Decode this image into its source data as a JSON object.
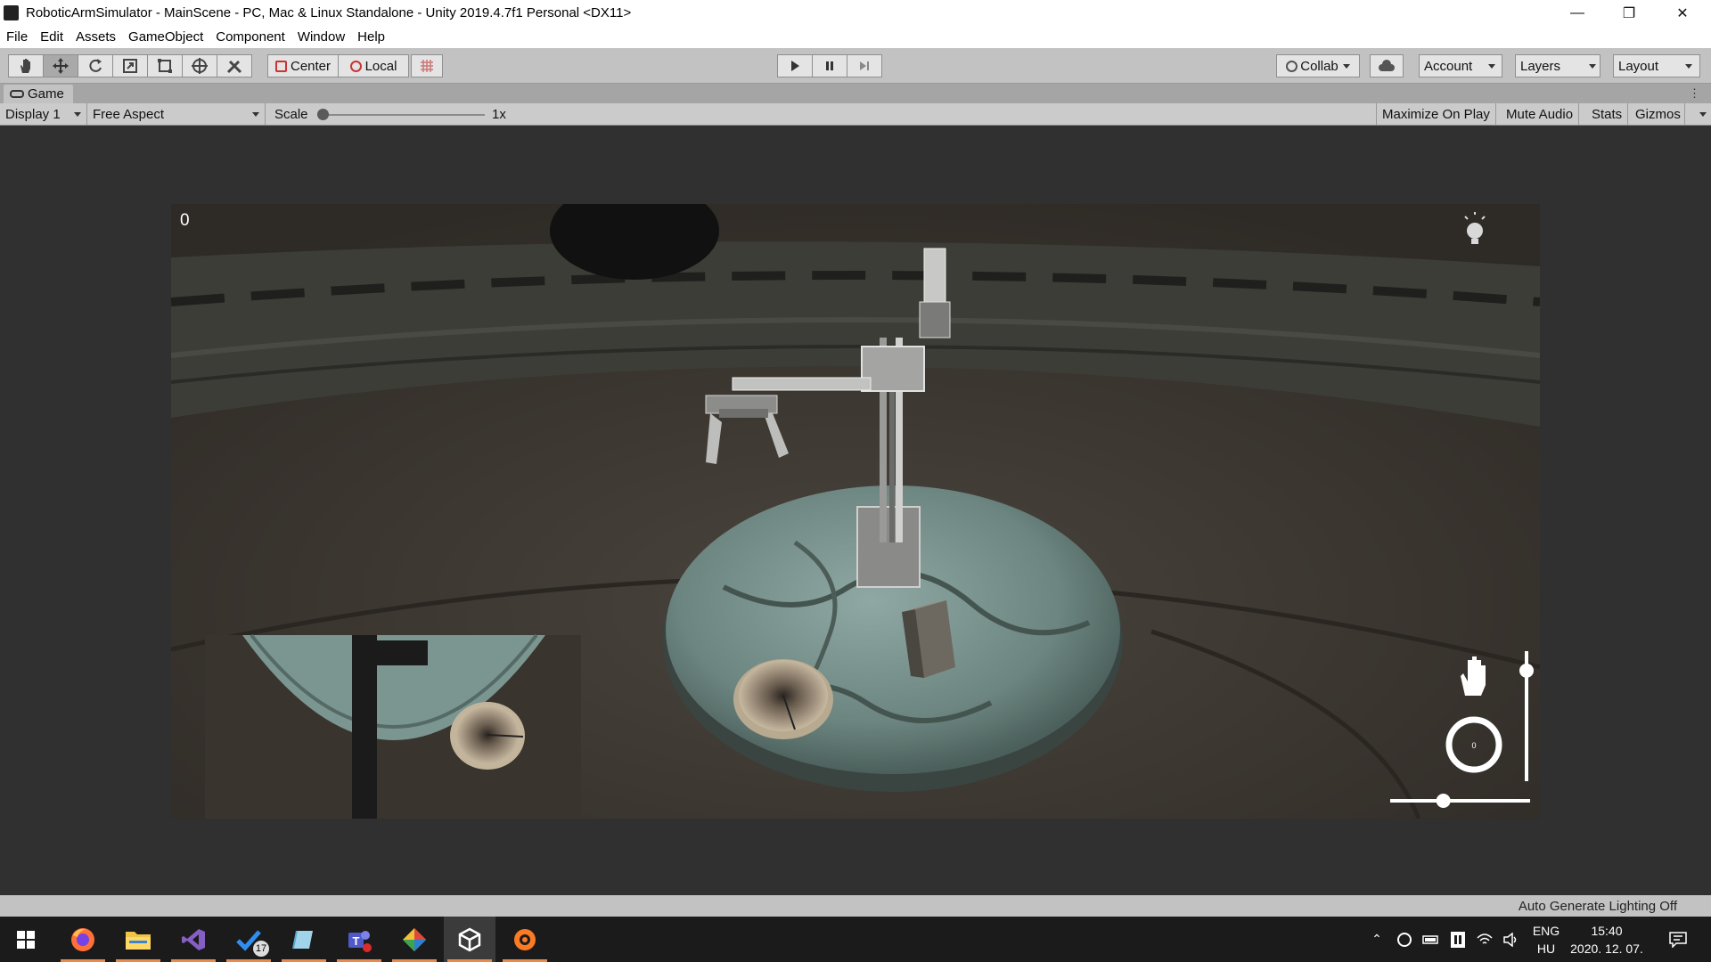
{
  "window": {
    "title": "RoboticArmSimulator - MainScene - PC, Mac & Linux Standalone - Unity 2019.4.7f1 Personal <DX11>",
    "minimize_glyph": "—",
    "maximize_glyph": "❐",
    "close_glyph": "✕"
  },
  "menu": [
    "File",
    "Edit",
    "Assets",
    "GameObject",
    "Component",
    "Window",
    "Help"
  ],
  "toolbar": {
    "tools": [
      "hand-tool-icon",
      "move-tool-icon",
      "rotate-tool-icon",
      "scale-tool-icon",
      "rect-tool-icon",
      "transform-tool-icon",
      "custom-tool-icon"
    ],
    "pivot_label": "Center",
    "space_label": "Local",
    "collab_label": "Collab",
    "account_label": "Account",
    "layers_label": "Layers",
    "layout_label": "Layout"
  },
  "game_tab": {
    "label": "Game"
  },
  "game_bar": {
    "display": "Display 1",
    "aspect": "Free Aspect",
    "scale_label": "Scale",
    "scale_value": "1x",
    "scale_fraction": 0.0,
    "maximize_on_play": "Maximize On Play",
    "mute_audio": "Mute Audio",
    "stats": "Stats",
    "gizmos": "Gizmos"
  },
  "scene": {
    "score": "0",
    "joystick_value": "0",
    "vertical_slider_fraction": 0.85,
    "horizontal_slider_fraction": 0.38
  },
  "status": {
    "text": "Auto Generate Lighting Off"
  },
  "taskbar": {
    "apps": [
      {
        "name": "start-button",
        "running": false
      },
      {
        "name": "firefox",
        "running": true
      },
      {
        "name": "file-explorer",
        "running": true
      },
      {
        "name": "visual-studio",
        "running": true
      },
      {
        "name": "todo",
        "running": true,
        "badge": "17"
      },
      {
        "name": "sketchbook",
        "running": true
      },
      {
        "name": "teams",
        "running": true
      },
      {
        "name": "gitkraken",
        "running": true
      },
      {
        "name": "unity",
        "running": true,
        "active": true
      },
      {
        "name": "xampp",
        "running": true
      }
    ],
    "lang_top": "ENG",
    "lang_bottom": "HU",
    "time": "15:40",
    "date": "2020. 12. 07."
  },
  "colors": {
    "accent_running": "#e88a4d",
    "toolbar_bg": "#c2c2c2",
    "editor_bg": "#303030"
  }
}
